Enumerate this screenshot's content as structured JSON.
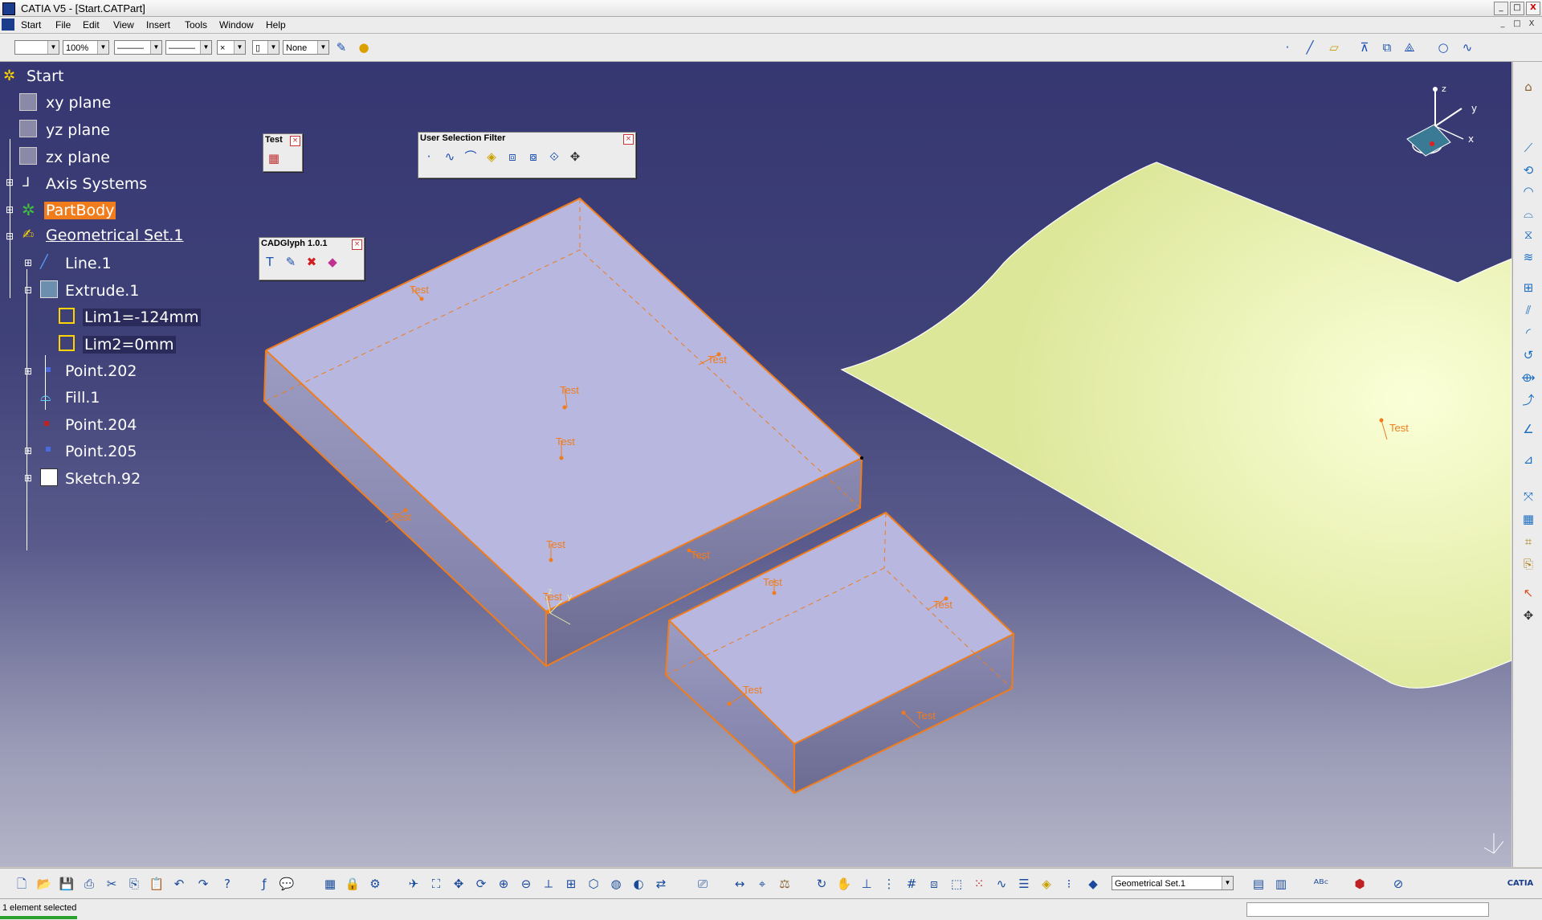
{
  "window": {
    "title": "CATIA V5 - [Start.CATPart]",
    "btn_min": "_",
    "btn_max": "□",
    "btn_close": "X"
  },
  "menu": {
    "items": [
      "Start",
      "File",
      "Edit",
      "View",
      "Insert",
      "Tools",
      "Window",
      "Help"
    ]
  },
  "toolbar_top": {
    "zoom": "100%",
    "layer": "None"
  },
  "tree": {
    "root": "Start",
    "xy": "xy plane",
    "yz": "yz plane",
    "zx": "zx plane",
    "axis": "Axis Systems",
    "partbody": "PartBody",
    "geoset": "Geometrical Set.1",
    "line": "Line.1",
    "extrude": "Extrude.1",
    "lim1": "Lim1=-124mm",
    "lim2": "Lim2=0mm",
    "point202": "Point.202",
    "fill": "Fill.1",
    "point204": "Point.204",
    "point205": "Point.205",
    "sketch": "Sketch.92"
  },
  "palettes": {
    "test": {
      "title": "Test"
    },
    "usf": {
      "title": "User Selection Filter"
    },
    "cadglyph": {
      "title": "CADGlyph 1.0.1"
    }
  },
  "labels": {
    "test": "Test"
  },
  "compass": {
    "x": "x",
    "y": "y",
    "z": "z"
  },
  "bottom": {
    "geoset_combo": "Geometrical Set.1",
    "catia": "CATIA"
  },
  "status": {
    "text": "1 element selected"
  },
  "colors": {
    "viewport": "#363772",
    "surface": "#e6eea2",
    "solid": "#b8b8e2",
    "edge": "#f07c1c"
  }
}
